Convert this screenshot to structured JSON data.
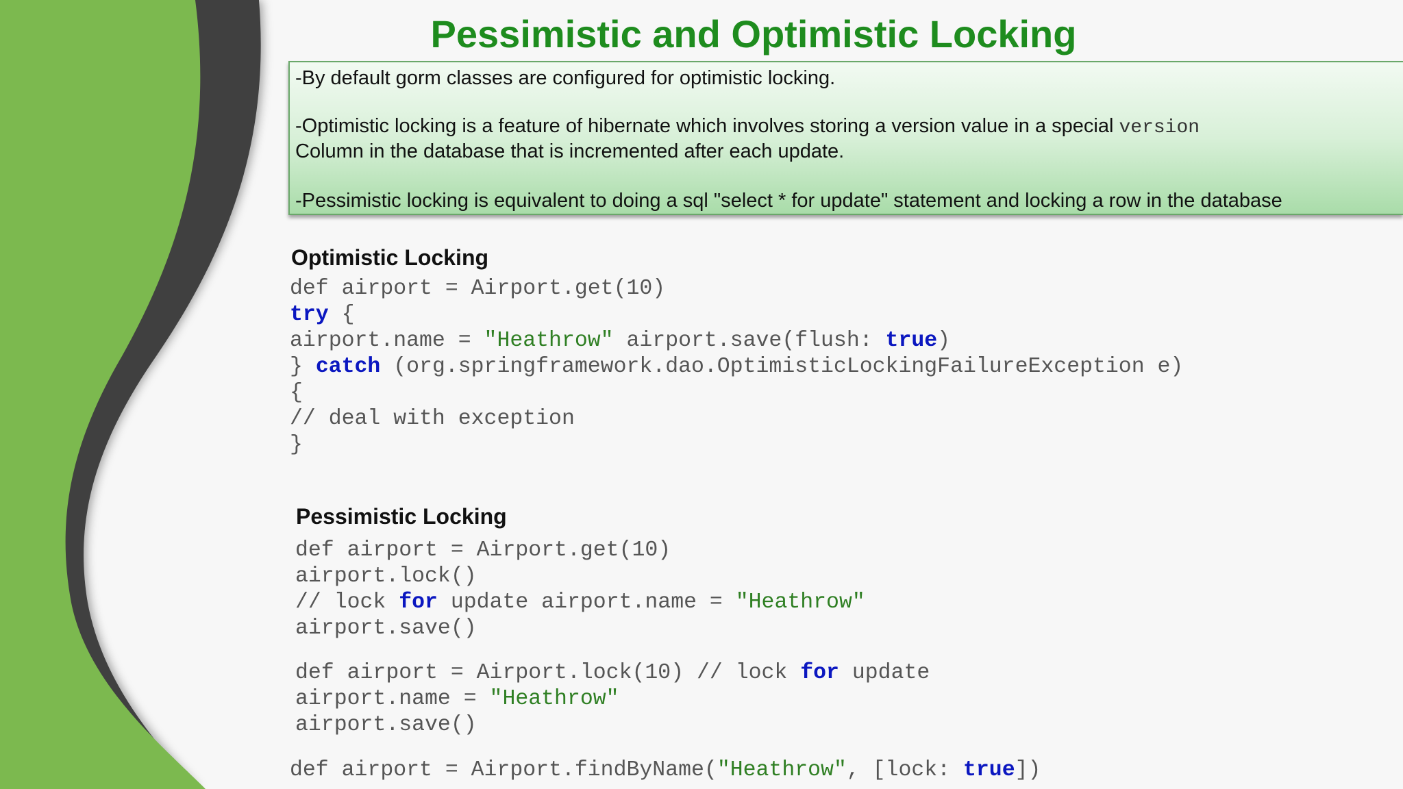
{
  "slide": {
    "title": "Pessimistic and Optimistic Locking",
    "colors": {
      "title": "#1e8c1e",
      "side_green": "#7cb94f",
      "side_dark": "#404040",
      "keyword": "#0b17c0",
      "string": "#2f7f23",
      "code_text": "#555555"
    }
  },
  "info_box": {
    "line1": "-By default gorm classes are configured for optimistic locking.",
    "line2_text": "-Optimistic locking is a feature of hibernate which involves storing a version value in a special ",
    "line2_code": "version",
    "line3": "Column in the database that is incremented after each update.",
    "line4": "-Pessimistic locking is equivalent to doing a sql \"select * for update\" statement and locking a row in the database"
  },
  "optimistic": {
    "heading": "Optimistic Locking",
    "c1": "def airport = Airport.get(10)",
    "c2_kw": "try",
    "c2_rest": " {",
    "c3_a": "airport.name = ",
    "c3_str": "\"Heathrow\"",
    "c3_b": " airport.save(flush: ",
    "c3_kw": "true",
    "c3_c": ")",
    "c4_a": "} ",
    "c4_kw": "catch",
    "c4_b": " (org.springframework.dao.OptimisticLockingFailureException e)",
    "c5": "{",
    "c6": "// deal with exception",
    "c7": "}"
  },
  "pessimistic": {
    "heading": "Pessimistic Locking",
    "a1": "def airport = Airport.get(10)",
    "a2": "airport.lock()",
    "a3_a": "// lock ",
    "a3_kw": "for",
    "a3_b": " update airport.name = ",
    "a3_str": "\"Heathrow\"",
    "a4": "airport.save()",
    "b1_a": "def airport = Airport.lock(10) // lock ",
    "b1_kw": "for",
    "b1_b": " update",
    "b2_a": "airport.name = ",
    "b2_str": "\"Heathrow\"",
    "b3": "airport.save()",
    "c1_a": "def airport = Airport.findByName(",
    "c1_str": "\"Heathrow\"",
    "c1_b": ", [lock: ",
    "c1_kw": "true",
    "c1_c": "])"
  }
}
